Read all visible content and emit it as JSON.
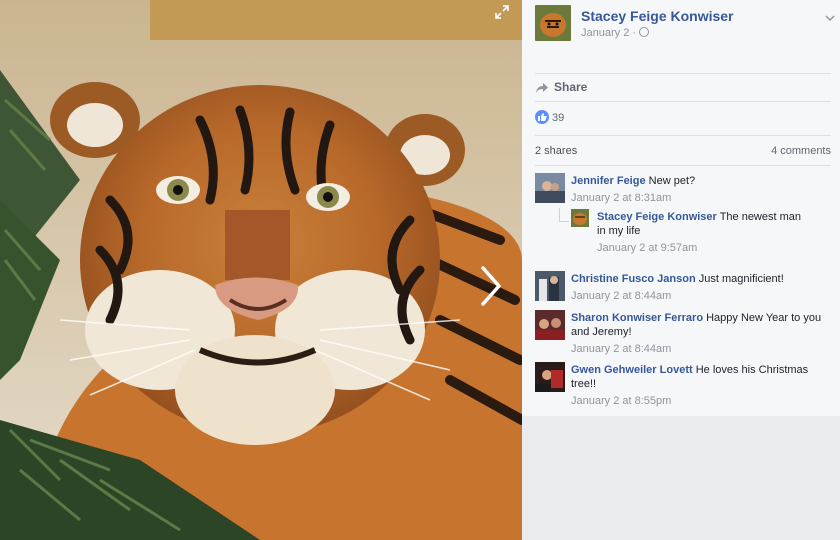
{
  "post": {
    "author": "Stacey Feige Konwiser",
    "date": "January 2",
    "meta_separator": "·",
    "privacy_icon": "globe-icon",
    "options_icon": "chevron-down-icon"
  },
  "actions": {
    "share_label": "Share",
    "share_icon": "share-arrow-icon"
  },
  "reactions": {
    "like_count": "39",
    "like_icon": "thumbs-up-icon",
    "like_color": "#5890ff"
  },
  "summary": {
    "shares": "2 shares",
    "comments": "4 comments"
  },
  "photo": {
    "expand_icon": "expand-icon",
    "next_icon": "chevron-right-icon"
  },
  "comments": [
    {
      "author": "Jennifer Feige",
      "text": "New pet?",
      "time": "January 2 at 8:31am"
    },
    {
      "author": "Stacey Feige Konwiser",
      "text": "The newest man in my life",
      "time": "January 2 at 9:57am"
    },
    {
      "author": "Christine Fusco Janson",
      "text": "Just magnificient!",
      "time": "January 2 at 8:44am"
    },
    {
      "author": "Sharon Konwiser Ferraro",
      "text": "Happy New Year to you and Jeremy!",
      "time": "January 2 at 8:44am"
    },
    {
      "author": "Gwen Gehweiler Lovett",
      "text": "He loves his Christmas tree!!",
      "time": "January 2 at 8:55pm"
    }
  ],
  "colors": {
    "link": "#365899",
    "muted": "#90949c",
    "panel_bg": "#f6f7f9",
    "page_bg": "#e9ebee"
  }
}
